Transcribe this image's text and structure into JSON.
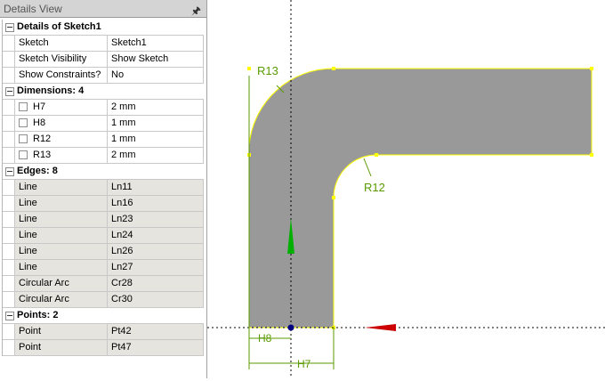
{
  "panel": {
    "title": "Details View",
    "pin_icon": "pin-icon",
    "sections": {
      "details": {
        "label": "Details of Sketch1",
        "rows": [
          {
            "name": "Sketch",
            "value": "Sketch1"
          },
          {
            "name": "Sketch Visibility",
            "value": "Show Sketch"
          },
          {
            "name": "Show Constraints?",
            "value": "No"
          }
        ]
      },
      "dimensions": {
        "label": "Dimensions: 4",
        "rows": [
          {
            "name": "H7",
            "value": "2 mm"
          },
          {
            "name": "H8",
            "value": "1 mm"
          },
          {
            "name": "R12",
            "value": "1 mm"
          },
          {
            "name": "R13",
            "value": "2 mm"
          }
        ]
      },
      "edges": {
        "label": "Edges: 8",
        "rows": [
          {
            "name": "Line",
            "value": "Ln11"
          },
          {
            "name": "Line",
            "value": "Ln16"
          },
          {
            "name": "Line",
            "value": "Ln23"
          },
          {
            "name": "Line",
            "value": "Ln24"
          },
          {
            "name": "Line",
            "value": "Ln26"
          },
          {
            "name": "Line",
            "value": "Ln27"
          },
          {
            "name": "Circular Arc",
            "value": "Cr28"
          },
          {
            "name": "Circular Arc",
            "value": "Cr30"
          }
        ]
      },
      "points": {
        "label": "Points: 2",
        "rows": [
          {
            "name": "Point",
            "value": "Pt42"
          },
          {
            "name": "Point",
            "value": "Pt47"
          }
        ]
      }
    }
  },
  "canvas": {
    "dimension_labels": {
      "r13": "R13",
      "r12": "R12",
      "h8": "H8",
      "h7": "H7"
    },
    "colors": {
      "shape_fill": "#999999",
      "sketch_edge": "#ffff00",
      "dimension": "#5a9a00",
      "x_axis": "#cc0000",
      "y_axis": "#00aa00",
      "origin": "#000080"
    }
  }
}
